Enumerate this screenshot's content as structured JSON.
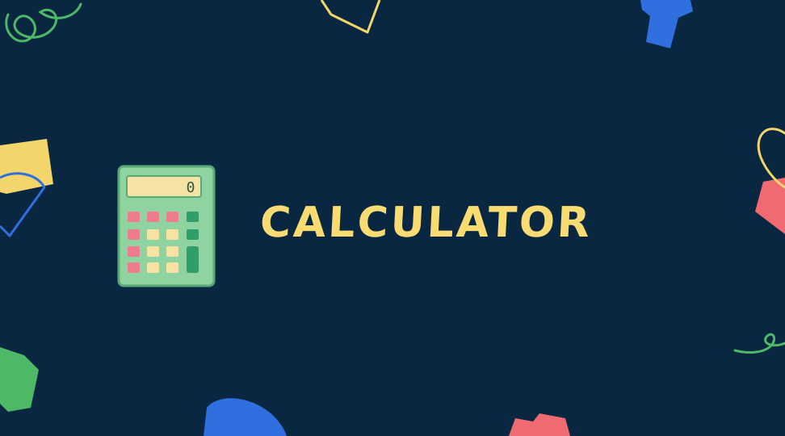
{
  "title": {
    "text": "CALCULATOR"
  },
  "calculator": {
    "display_text": "0"
  },
  "colors": {
    "background": "#0a2742",
    "title": "#f8dc72",
    "calc_body": "#8fd3a0",
    "calc_key_pink": "#ef7c8e",
    "calc_key_yellow": "#f6e3a4",
    "calc_key_green": "#2f9e6b",
    "accent_blue": "#2f6fe0",
    "accent_yellow": "#f2d66b",
    "accent_red": "#f06a72",
    "accent_green": "#4db865"
  }
}
